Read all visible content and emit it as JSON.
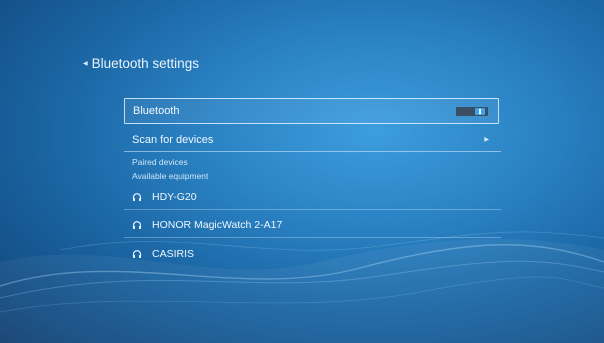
{
  "header": {
    "title": "Bluetooth settings"
  },
  "bluetooth": {
    "label": "Bluetooth",
    "enabled": true
  },
  "scan": {
    "label": "Scan for devices"
  },
  "sections": {
    "paired": "Paired devices",
    "available": "Available equipment"
  },
  "devices": [
    {
      "name": "HDY-G20",
      "icon": "headphones-icon"
    },
    {
      "name": "HONOR MagicWatch 2-A17",
      "icon": "headphones-icon"
    },
    {
      "name": "CASIRIS",
      "icon": "headphones-icon"
    }
  ],
  "colors": {
    "background": "#1f6fb0",
    "accent": "#3ea2ee",
    "switch_track": "#3b4f62"
  }
}
